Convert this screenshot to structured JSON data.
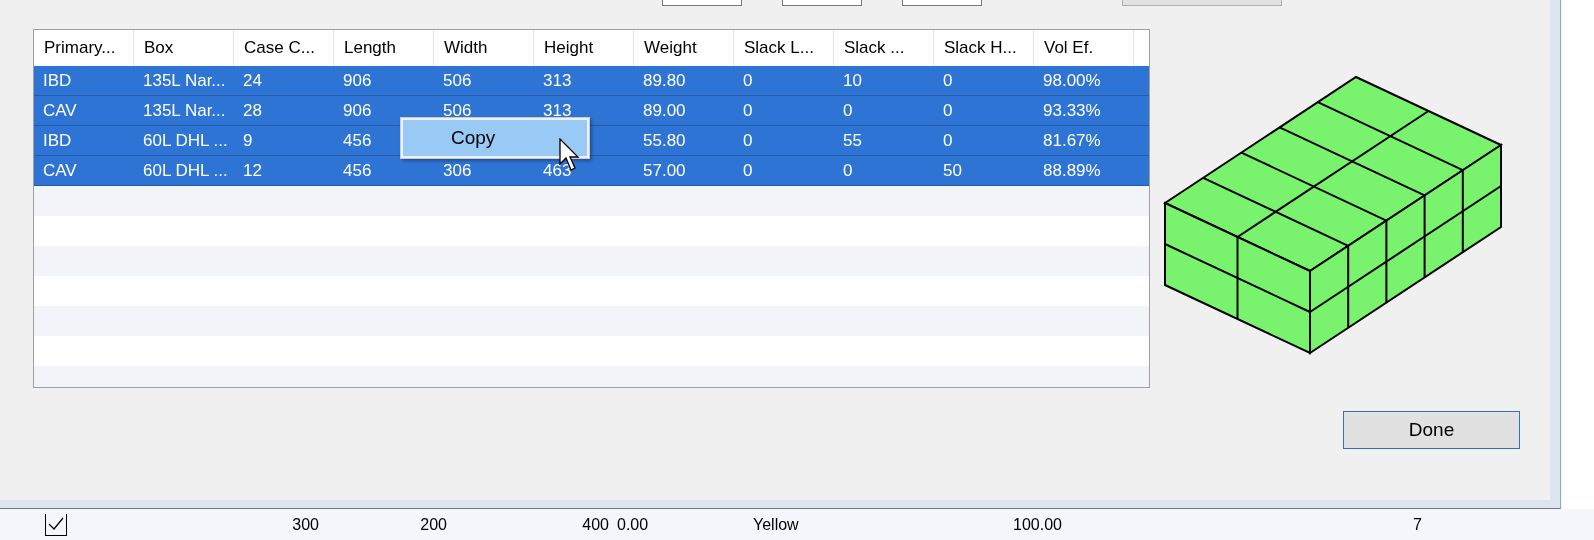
{
  "table": {
    "columns": [
      "Primary...",
      "Box",
      "Case C...",
      "Length",
      "Width",
      "Height",
      "Weight",
      "Slack L...",
      "Slack ...",
      "Slack H...",
      "Vol Ef."
    ],
    "rows": [
      {
        "selected": true,
        "cells": [
          "IBD",
          "135L Nar...",
          "24",
          "906",
          "506",
          "313",
          "89.80",
          "0",
          "10",
          "0",
          "98.00%"
        ]
      },
      {
        "selected": true,
        "cells": [
          "CAV",
          "135L Nar...",
          "28",
          "906",
          "506",
          "313",
          "89.00",
          "0",
          "0",
          "0",
          "93.33%"
        ]
      },
      {
        "selected": true,
        "cells": [
          "IBD",
          "60L DHL ...",
          "9",
          "456",
          null,
          null,
          "55.80",
          "0",
          "55",
          "0",
          "81.67%"
        ]
      },
      {
        "selected": true,
        "cells": [
          "CAV",
          "60L DHL ...",
          "12",
          "456",
          "306",
          "463",
          "57.00",
          "0",
          "0",
          "50",
          "88.89%"
        ]
      }
    ]
  },
  "context_menu": {
    "items": [
      {
        "label": "Copy",
        "selected": true
      }
    ]
  },
  "done_button": "Done",
  "background_row": {
    "checked": true,
    "cells": [
      "300",
      "200",
      "400",
      "0.00",
      "Yellow",
      "100.00",
      "7"
    ]
  }
}
